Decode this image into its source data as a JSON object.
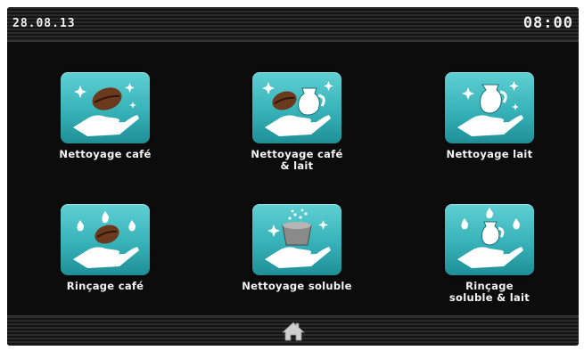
{
  "status_bar": {
    "date": "28.08.13",
    "time": "08:00"
  },
  "tiles": [
    {
      "label": "Nettoyage café",
      "icon": "coffee-bean-clean-icon"
    },
    {
      "label": "Nettoyage café\n& lait",
      "icon": "coffee-milk-clean-icon"
    },
    {
      "label": "Nettoyage lait",
      "icon": "milk-clean-icon"
    },
    {
      "label": "Rinçage café",
      "icon": "coffee-rinse-icon"
    },
    {
      "label": "Nettoyage soluble",
      "icon": "soluble-clean-icon"
    },
    {
      "label": "Rinçage\nsoluble & lait",
      "icon": "soluble-milk-rinse-icon"
    }
  ],
  "nav": {
    "icon": "home-icon"
  },
  "colors": {
    "tile": "#36b2b8",
    "background": "#0c0c0c",
    "text": "#f5f5f5"
  }
}
